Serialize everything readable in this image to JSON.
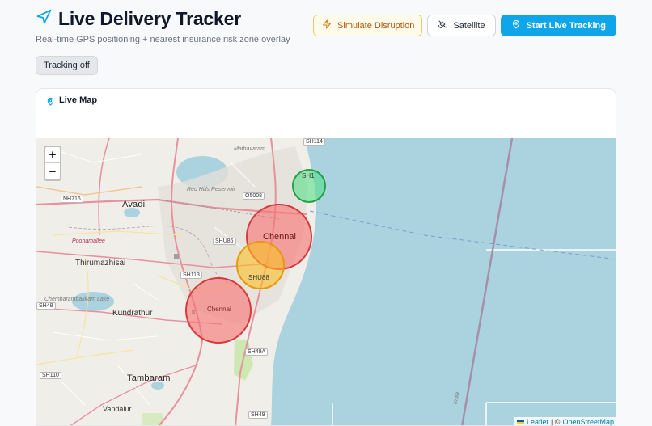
{
  "header": {
    "title": "Live Delivery Tracker",
    "subtitle": "Real-time GPS positioning + nearest insurance risk zone overlay"
  },
  "actions": {
    "disruption_label": "Simulate Disruption",
    "satellite_label": "Satellite",
    "tracking_label": "Start Live Tracking"
  },
  "status": {
    "tracking": "Tracking off"
  },
  "map_card": {
    "title": "Live Map",
    "zoom_in": "+",
    "zoom_out": "−",
    "attribution": {
      "leaflet": "Leaflet",
      "separator": "| ©",
      "osm": "OpenStreetMap"
    }
  },
  "map_labels": {
    "avadi": "Avadi",
    "chennai": "Chennai",
    "chennai_small": "Chennai",
    "thirumazhisai": "Thirumazhisai",
    "kundrathur": "Kundrathur",
    "tambaram": "Tambaram",
    "vandalur": "Vandalur",
    "mathavaram": "Mathavaram",
    "red_hills": "Red Hills Reservoir",
    "poonamallee": "Poonamallee",
    "chembarambakkam": "Chembarambakkam Lake",
    "india": "India"
  },
  "road_shields": {
    "sh114": "SH114",
    "sh1": "SH1",
    "nh716": "NH716",
    "o5008": "O5008",
    "shu86": "SHU86",
    "sh113": "SH113",
    "shu88": "SHU88",
    "sh48": "SH48",
    "sh49a": "SH49A",
    "sh110": "SH110",
    "sh49": "SH49"
  },
  "risk_zones": [
    {
      "id": "SH1",
      "level": "low",
      "color": "#22c55e"
    },
    {
      "id": "Chennai",
      "level": "high",
      "color": "#ef4444"
    },
    {
      "id": "SHU88",
      "level": "medium",
      "color": "#f59e0b"
    },
    {
      "id": "Chennai",
      "level": "high",
      "color": "#ef4444"
    }
  ],
  "colors": {
    "accent": "#0ea5e9",
    "warn": "#b45309",
    "sea": "#aad3df"
  }
}
